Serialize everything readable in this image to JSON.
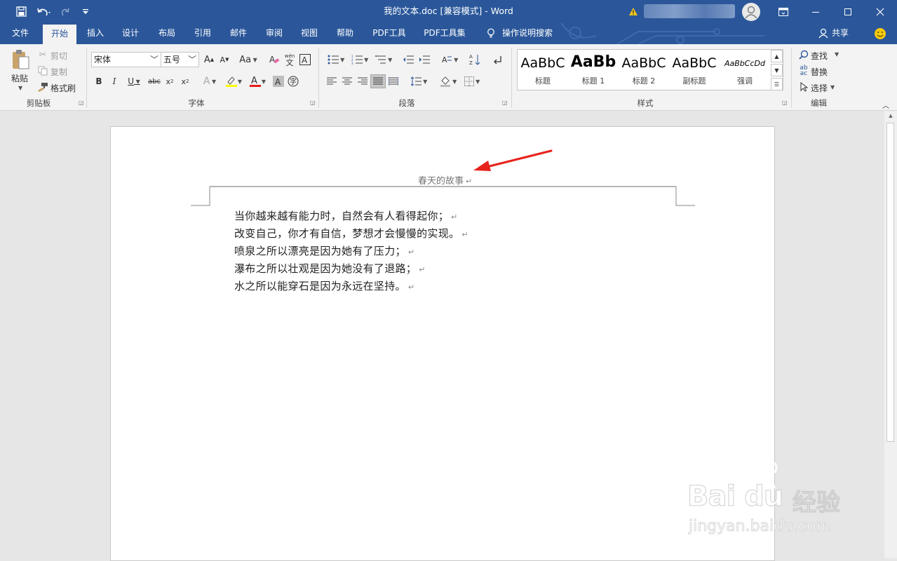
{
  "window": {
    "title": "我的文本.doc [兼容模式]  -  Word",
    "controls": {
      "ribbon_display": "ribbon-display-icon",
      "minimize": "minimize-icon",
      "maximize": "maximize-icon",
      "close": "close-icon"
    }
  },
  "quick_access": {
    "save": "save-icon",
    "undo": "undo-icon",
    "redo": "redo-icon",
    "customize": "customize-icon"
  },
  "menu": {
    "tabs": [
      "文件",
      "开始",
      "插入",
      "设计",
      "布局",
      "引用",
      "邮件",
      "审阅",
      "视图",
      "帮助",
      "PDF工具",
      "PDF工具集"
    ],
    "active_tab": "开始",
    "tell_me": "操作说明搜索",
    "share": "共享"
  },
  "ribbon": {
    "clipboard": {
      "label": "剪贴板",
      "paste": "粘贴",
      "cut": "剪切",
      "copy": "复制",
      "format_painter": "格式刷"
    },
    "font": {
      "label": "字体",
      "font_name": "宋体",
      "font_size": "五号",
      "case_label": "Aa"
    },
    "paragraph": {
      "label": "段落"
    },
    "styles": {
      "label": "样式",
      "items": [
        {
          "sample": "AaBbC",
          "name": "标题"
        },
        {
          "sample": "AaBb",
          "name": "标题 1"
        },
        {
          "sample": "AaBbC",
          "name": "标题 2"
        },
        {
          "sample": "AaBbC",
          "name": "副标题"
        },
        {
          "sample": "AaBbCcDd",
          "name": "强调"
        }
      ]
    },
    "editing": {
      "label": "编辑",
      "find": "查找",
      "replace": "替换",
      "select": "选择"
    }
  },
  "document": {
    "header_text": "春天的故事",
    "paragraph_mark": "↵",
    "lines": [
      "当你越来越有能力时，自然会有人看得起你；",
      "改变自己，你才有自信，梦想才会慢慢的实现。",
      "喷泉之所以漂亮是因为她有了压力；",
      "瀑布之所以壮观是因为她没有了退路；",
      "水之所以能穿石是因为永远在坚持。"
    ]
  },
  "watermark": {
    "brand": "Bai du",
    "cn": "经验",
    "url": "jingyan.baidu.com"
  },
  "colors": {
    "titlebar": "#2b579a",
    "ribbon_bg": "#f3f3f3",
    "doc_bg": "#e6e6e6",
    "annotation_arrow": "#e8231b"
  }
}
